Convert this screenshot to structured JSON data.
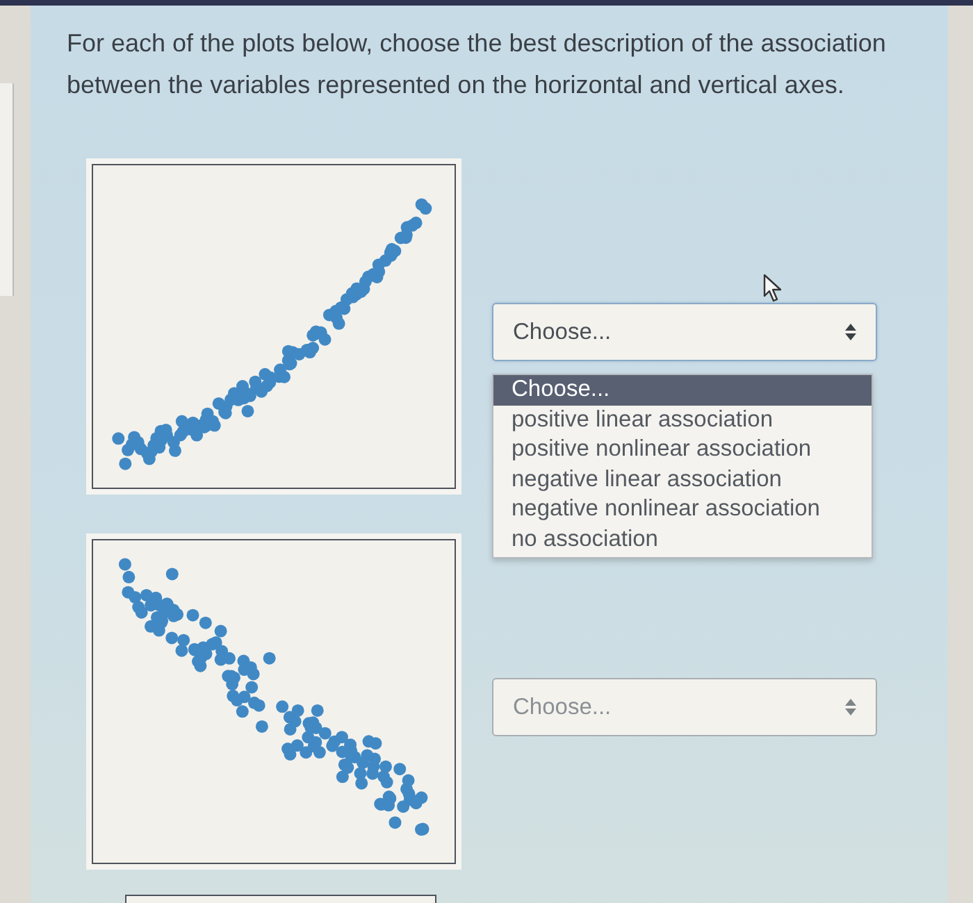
{
  "instructions": "For each of the plots below, choose the best description of the association between the variables represented on the horizontal and vertical axes.",
  "questions": [
    {
      "plot": {
        "kind": "rising"
      },
      "select": {
        "value": "Choose...",
        "open": true,
        "options": [
          {
            "label": "Choose...",
            "selected": true
          },
          {
            "label": "positive linear association",
            "selected": false
          },
          {
            "label": "positive nonlinear association",
            "selected": false
          },
          {
            "label": "negative linear association",
            "selected": false
          },
          {
            "label": "negative nonlinear association",
            "selected": false
          },
          {
            "label": "no association",
            "selected": false
          }
        ]
      }
    },
    {
      "plot": {
        "kind": "falling"
      },
      "select": {
        "value": "Choose...",
        "open": false
      }
    }
  ]
}
